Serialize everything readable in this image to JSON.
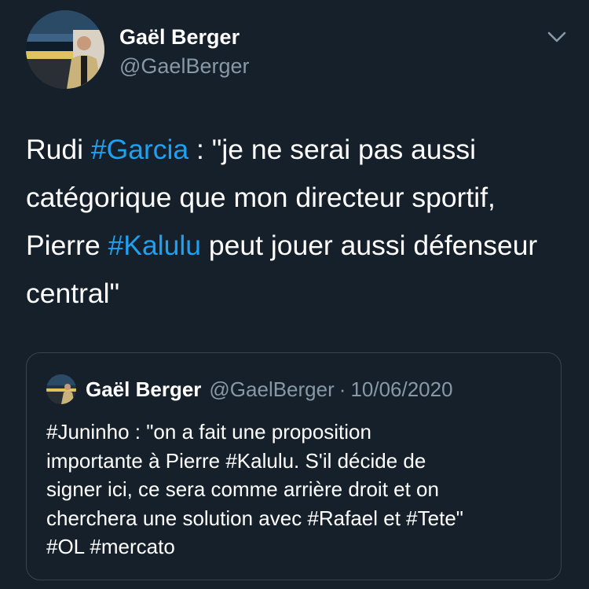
{
  "author": {
    "name": "Gaël Berger",
    "handle": "@GaelBerger"
  },
  "tweet": {
    "segments": [
      {
        "text": "Rudi ",
        "type": "text"
      },
      {
        "text": "#Garcia",
        "type": "hashtag"
      },
      {
        "text": " : \"je ne serai pas aussi catégorique que mon directeur sportif, Pierre ",
        "type": "text"
      },
      {
        "text": "#Kalulu",
        "type": "hashtag"
      },
      {
        "text": " peut jouer aussi défenseur central\"",
        "type": "text"
      }
    ]
  },
  "quoted": {
    "name": "Gaël Berger",
    "handle": "@GaelBerger",
    "separator": "·",
    "date": "10/06/2020",
    "lines": [
      "#Juninho : \"on a fait une proposition",
      "importante à Pierre #Kalulu. S'il décide de",
      "signer ici, ce sera comme arrière droit et on",
      "cherchera une solution avec #Rafael et #Tete\"",
      "#OL #mercato"
    ]
  },
  "icons": {
    "menu": "chevron-down-icon",
    "avatar": "avatar-image"
  },
  "colors": {
    "background": "#15202b",
    "hashtag": "#1da1f2",
    "secondary_text": "#8899a6",
    "border": "#38444d"
  }
}
